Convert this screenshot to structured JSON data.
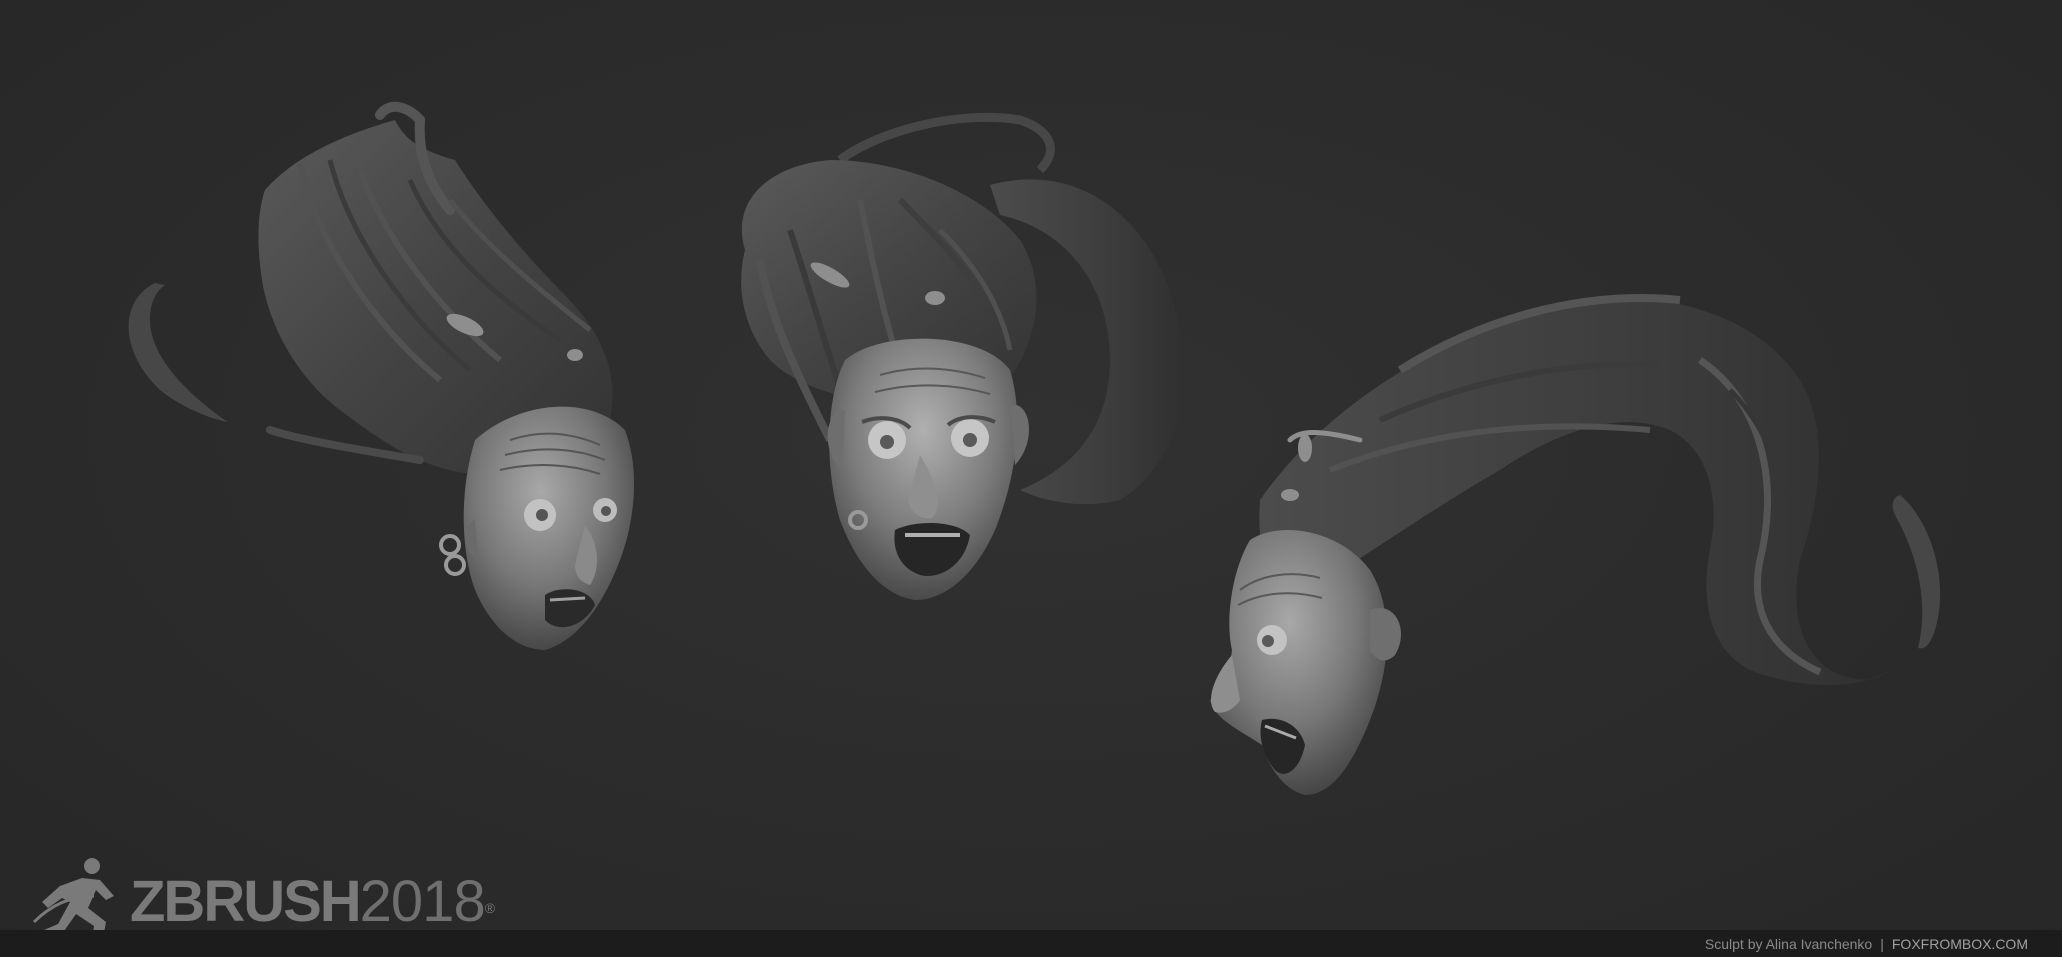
{
  "logo": {
    "brand": "ZBRUSH",
    "year": "2018",
    "reg": "®",
    "icon": "zbrush-figure-icon"
  },
  "footer": {
    "credit": "Sculpt by Alina Ivanchenko",
    "separator": "|",
    "site": "FOXFROMBOX.COM"
  },
  "colors": {
    "background": "#2c2c2c",
    "footer_bar": "#1c1c1c",
    "sculpt_light": "#9a9a9a",
    "sculpt_dark": "#2e2e2e"
  }
}
